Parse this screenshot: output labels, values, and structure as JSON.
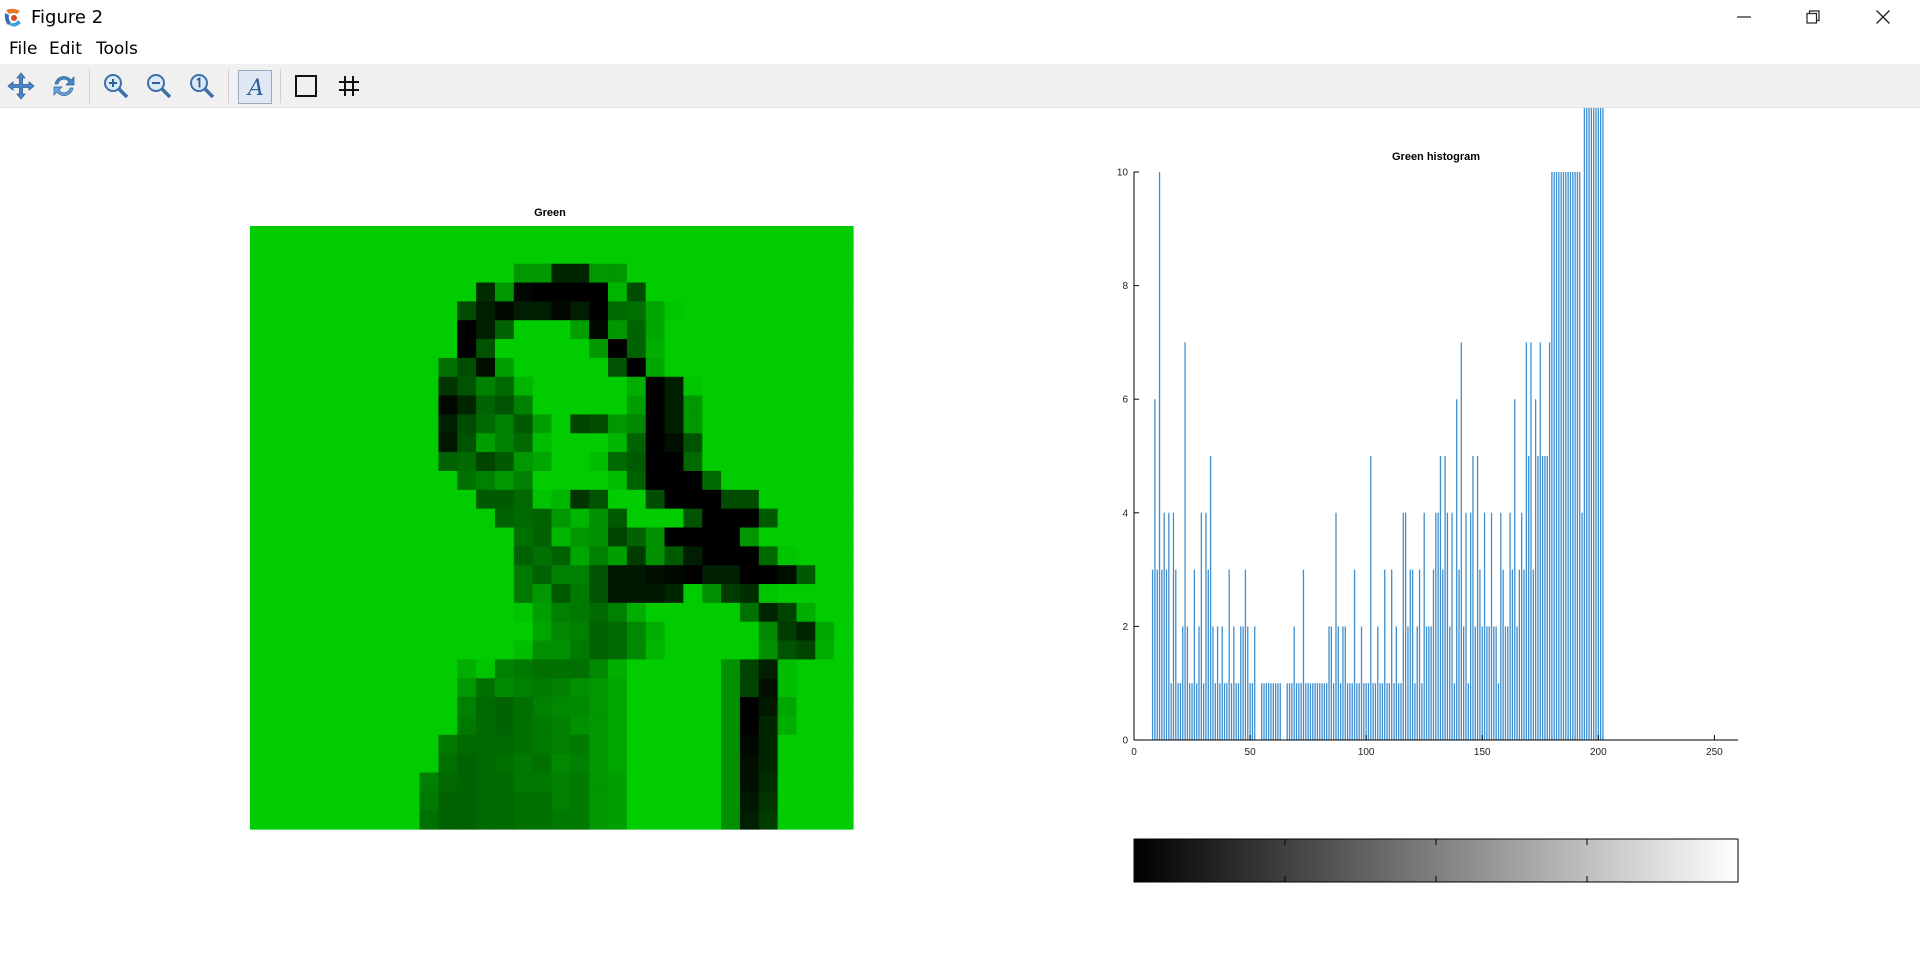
{
  "window": {
    "title": "Figure 2"
  },
  "menu": {
    "items": [
      "File",
      "Edit",
      "Tools"
    ]
  },
  "toolbar": {
    "tools": [
      "pan-icon",
      "rotate-icon",
      "zoom-in-icon",
      "zoom-out-icon",
      "zoom-reset-icon",
      "insert-text-icon",
      "toggle-axes-icon",
      "toggle-grid-icon"
    ]
  },
  "image_panel": {
    "title": "Green",
    "colormap_colors": [
      "#000000",
      "#00cc00"
    ],
    "grid_size": 32,
    "pixel_levels": [
      "RRRRRRRRRRRRRRRRRRRRRRRRRRRRRRRR",
      "RRRRRRRRRRRRRRRRRRRRRRRRRRRRRRRR",
      "RRRRRRRRRRRRRRKK55KKRRRRRRRRRRRR",
      "RRRRRRRRRRRR6K10000OARRRRRRRRRRR",
      "RRRRRRRRRRRA4144140EFMQRRRRRRRRRR",
      "RRRRRRRRRRR04DSSSL1KDMRRRRRRRRRRR",
      "RRRRRRRRRRR0BSSSSSK0DNRRRRRRRRRRR",
      "RRRRRRRRRRFA2LSSSSSB0MRRRRRRRRRRR",
      "RRRRRRRRRR7BHEOSSSSSN04QRRRRRRRRR",
      "RRRRRRRRRR15DBHSSSSSL04KRRRRRRRRR",
      "RRRRRRRRRR4AEHCLS9AKI04KRRRRRRRRR",
      "RRRRRRRRRR3BLHEPSSSOD02BRRRRRRRRR",
      "RRRRRRRRRRDE9CKMSSPEC00ERRRRRRRRR",
      "RRRRRRRRRRRFHKHSSSSPD000ERRRRRRRRR",
      "RRRRRRRRRRRRCCEQO7BSSA000AARRRRRRRRR",
      "RRRRRRRRRRRRRDEDKOJCSRSB000CRRRRRRRRR",
      "RRRRRRRRRRRRRRFDOKJ9DJ0000KRRRRRRRRR",
      "RRRRRRRRRRRRRRDFDMHL8JC4000EQRRRRRRRR",
      "RRRRRRRRRRRRRRGDHHB3321044002CRRRRRRRR",
      "RRRRRRRRRRRRRRGKCGB3335RJ86QRRRRRRR",
      "RRRRRRRRRRRRRRQLHGEHNSSSSSF59NRRRRRRR",
      "RRRRRRRRRRRRRRRMIHDEINSSSSSI85MRRRRRRR",
      "RRRRRRRRRRRRRRPJJGDEIOSSSSSJB9NRRRRRRR",
      "RRRRRRRRRRRNQHGFFFINSSSSSJ94PRRRRRRR",
      "RRRRRRRRRRRKFIHGHJKMSSSSSJ92PRRRRRRR",
      "RRRRRRRRRRRHEDFHIIKMSSSSSJ03MRRRRRRR",
      "RRRRRRRRRRRGEDFGHJKMSSSSSJ05NRRRRRRR",
      "RRRRRRRRRRGEEEFGHGKMSSSSSJ15RRRRRRRR",
      "RRRRRRRRRRFDEFGFIHKMSSSSSJ25RRRRRRRR",
      "RRRRRRRRRHEDEEGGHGKLSSSSSJ26RRRRRRRR",
      "RRRRRRRRRGDDEEFFHGKLSSSSSJ37RRRRRRRR",
      "RRRRRRRRRFDDEEFFGGKLSSSSSJ48RRRRRRRR"
    ]
  },
  "histogram": {
    "chart_data": {
      "type": "bar",
      "title": "Green histogram",
      "xlim": [
        0,
        255
      ],
      "ylim": [
        0,
        10
      ],
      "xticks": [
        0,
        50,
        100,
        150,
        200,
        250
      ],
      "yticks": [
        0,
        2,
        4,
        6,
        8,
        10
      ],
      "bar_color": "#3f8fd0",
      "x": [
        8,
        9,
        10,
        11,
        12,
        13,
        14,
        15,
        16,
        17,
        18,
        19,
        20,
        21,
        22,
        23,
        24,
        25,
        26,
        27,
        28,
        29,
        30,
        31,
        32,
        33,
        34,
        35,
        36,
        37,
        38,
        39,
        40,
        41,
        42,
        43,
        44,
        45,
        46,
        47,
        48,
        49,
        50,
        51,
        52,
        55,
        56,
        57,
        58,
        59,
        60,
        61,
        62,
        63,
        66,
        67,
        68,
        69,
        70,
        71,
        72,
        73,
        74,
        75,
        76,
        77,
        78,
        79,
        80,
        81,
        82,
        83,
        84,
        85,
        86,
        87,
        88,
        89,
        90,
        91,
        92,
        93,
        94,
        95,
        96,
        97,
        98,
        99,
        100,
        101,
        102,
        103,
        104,
        105,
        106,
        107,
        108,
        109,
        110,
        111,
        112,
        113,
        114,
        115,
        116,
        117,
        118,
        119,
        120,
        121,
        122,
        123,
        124,
        125,
        126,
        127,
        128,
        129,
        130,
        131,
        132,
        133,
        134,
        135,
        136,
        137,
        138,
        139,
        140,
        141,
        142,
        143,
        144,
        145,
        146,
        147,
        148,
        149,
        150,
        151,
        152,
        153,
        154,
        155,
        156,
        157,
        158,
        159,
        160,
        161,
        162,
        163,
        164,
        165,
        166,
        167,
        168,
        169,
        170,
        171,
        172,
        173,
        174,
        175,
        176,
        177,
        178,
        179,
        180,
        181,
        182,
        183,
        184,
        185,
        186,
        187,
        188,
        189,
        190,
        191,
        192,
        193,
        194,
        195,
        196,
        197,
        198,
        199,
        200,
        201,
        202
      ],
      "values": [
        3,
        6,
        3,
        10,
        3,
        4,
        3,
        4,
        1,
        4,
        3,
        1,
        1,
        2,
        7,
        2,
        1,
        1,
        3,
        1,
        2,
        4,
        1,
        4,
        3,
        5,
        2,
        1,
        2,
        1,
        2,
        1,
        1,
        3,
        1,
        2,
        1,
        1,
        2,
        2,
        3,
        2,
        1,
        1,
        2,
        1,
        1,
        1,
        1,
        1,
        1,
        1,
        1,
        1,
        1,
        1,
        1,
        2,
        1,
        1,
        1,
        3,
        1,
        1,
        1,
        1,
        1,
        1,
        1,
        1,
        1,
        1,
        2,
        2,
        1,
        4,
        2,
        1,
        2,
        2,
        1,
        1,
        1,
        3,
        1,
        1,
        2,
        1,
        1,
        1,
        5,
        1,
        1,
        2,
        1,
        1,
        3,
        1,
        1,
        3,
        1,
        2,
        1,
        1,
        4,
        4,
        2,
        3,
        3,
        1,
        2,
        3,
        1,
        4,
        2,
        2,
        2,
        3,
        4,
        4,
        5,
        3,
        5,
        4,
        2,
        4,
        1,
        6,
        3,
        7,
        2,
        4,
        1,
        4,
        5,
        2,
        5,
        3,
        2,
        4,
        2,
        2,
        4,
        2,
        2,
        1,
        4,
        3,
        2,
        2,
        4,
        3,
        6,
        2,
        3,
        4,
        3,
        7,
        5,
        7,
        3,
        6,
        5,
        7,
        5,
        5,
        5,
        7,
        10,
        10,
        10,
        10,
        10,
        10,
        10,
        10,
        10,
        10,
        10,
        10,
        10,
        4
      ]
    }
  },
  "colorbar": {
    "colormap_colors": [
      "#000000",
      "#ffffff"
    ]
  }
}
